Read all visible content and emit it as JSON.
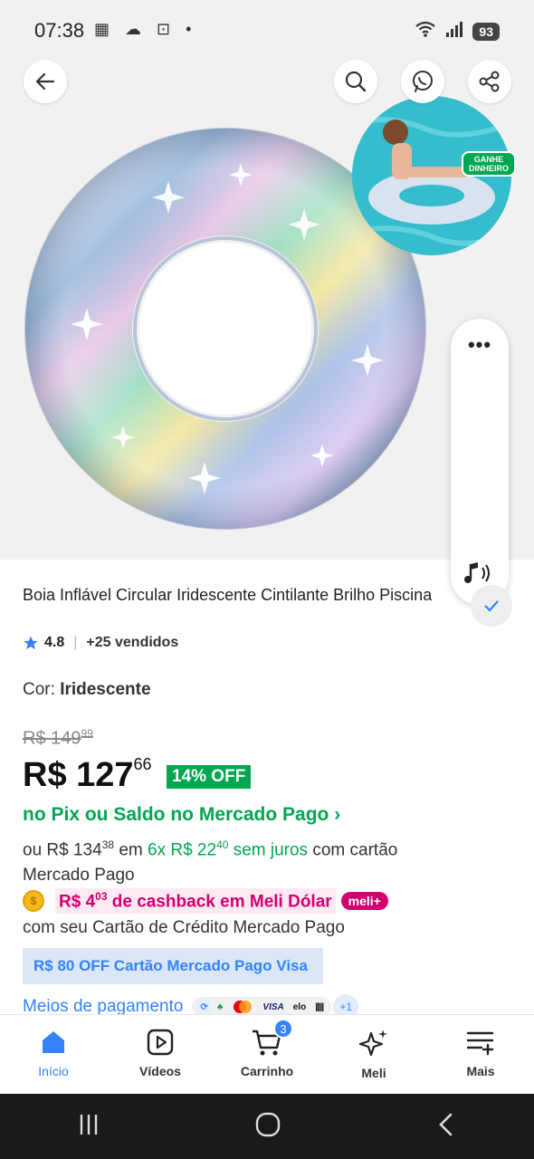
{
  "status_bar": {
    "time": "07:38",
    "battery": "93"
  },
  "hero": {
    "back_label": "back",
    "earn_badge": "GANHE DINHEIRO",
    "side_panel_dots": "•••"
  },
  "product": {
    "title": "Boia Inflável Circular Iridescente Cintilante Brilho Piscina",
    "rating": "4.8",
    "sold": "+25 vendidos",
    "color_label": "Cor:",
    "color_value": "Iridescente",
    "old_price": {
      "currency": "R$",
      "int": "149",
      "cents": "99"
    },
    "price": {
      "currency": "R$",
      "int": "127",
      "cents": "66"
    },
    "discount": "14% OFF",
    "pix_text": "no Pix ou Saldo no Mercado Pago ›",
    "installments": {
      "prefix": "ou R$ 134",
      "prefix_cents": "38",
      "mid": "em",
      "plan": "6x R$ 22",
      "plan_cents": "40",
      "no_interest": "sem juros",
      "suffix": "com cartão Mercado Pago"
    },
    "cashback": {
      "amount_int": "R$ 4",
      "amount_cents": "03",
      "text": "de cashback em Meli Dólar",
      "pill": "meli+"
    },
    "card_text": "com seu Cartão de Crédito Mercado Pago",
    "promo": "R$ 80 OFF Cartão Mercado Pago Visa",
    "payment_label": "Meios de pagamento",
    "payment_chips": [
      "VISA",
      "elo"
    ],
    "payment_more": "+1"
  },
  "bottom_nav": {
    "items": [
      {
        "label": "Início"
      },
      {
        "label": "Vídeos"
      },
      {
        "label": "Carrinho"
      },
      {
        "label": "Meli"
      },
      {
        "label": "Mais"
      }
    ],
    "cart_count": "3"
  },
  "colors": {
    "accent_blue": "#3483fa",
    "green": "#00a650",
    "pink": "#d0006f"
  }
}
